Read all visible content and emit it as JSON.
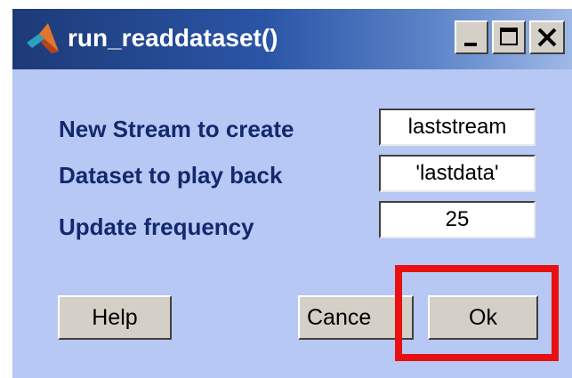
{
  "window": {
    "title": "run_readdataset()",
    "minimize_label": "minimize",
    "maximize_label": "maximize",
    "close_label": "close"
  },
  "form": {
    "fields": [
      {
        "label": "New Stream to create",
        "value": "laststream"
      },
      {
        "label": "Dataset to play back",
        "value": "'lastdata'"
      },
      {
        "label": "Update frequency",
        "value": "25"
      }
    ]
  },
  "buttons": {
    "help": "Help",
    "cancel": "Cance",
    "ok": "Ok"
  },
  "icons": {
    "app": "matlab-logo-icon",
    "minimize": "minimize-icon",
    "maximize": "maximize-icon",
    "close": "close-icon"
  },
  "colors": {
    "dialog_background": "#b7c8f4",
    "label_text": "#14286e",
    "highlight": "#e81010"
  }
}
